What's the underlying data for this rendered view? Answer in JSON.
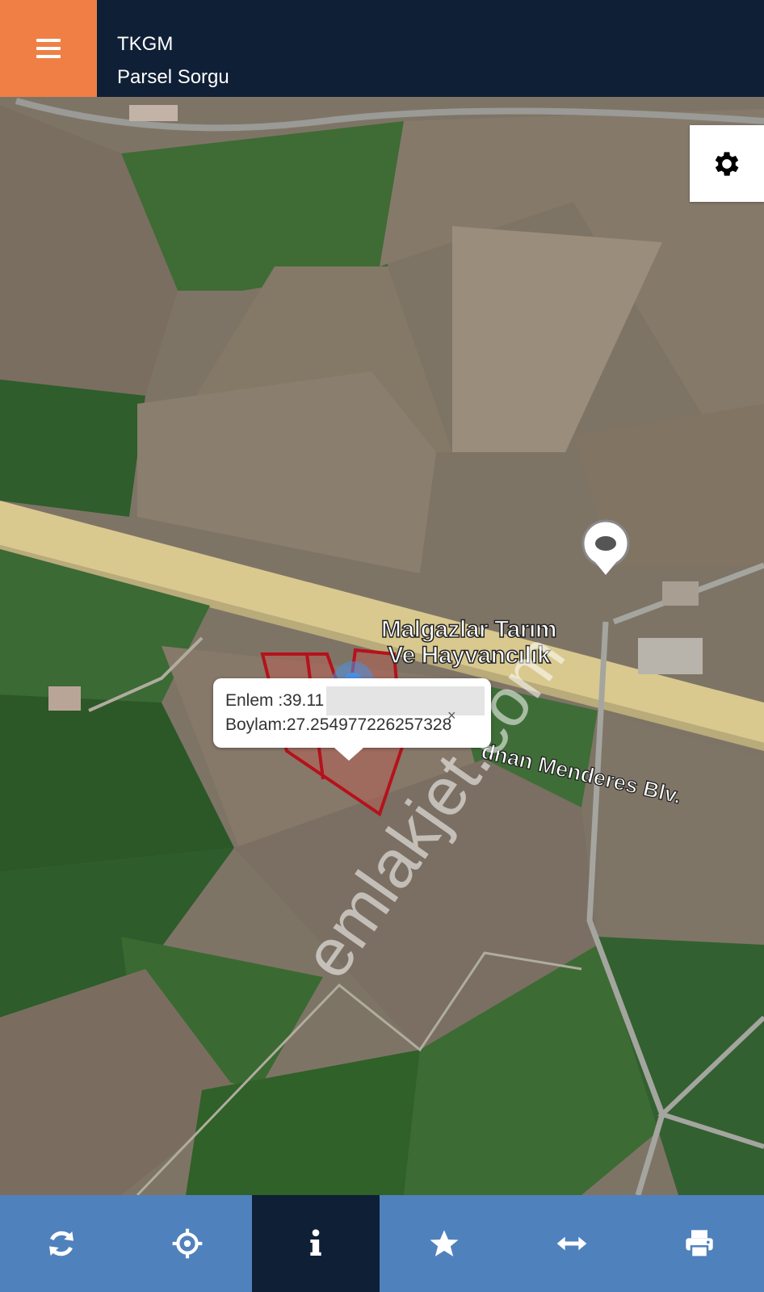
{
  "header": {
    "app_name": "TKGM",
    "subtitle": "Parsel Sorgu",
    "menu_icon": "hamburger-menu-icon"
  },
  "map": {
    "poi_label_line1": "Malgazlar Tarım",
    "poi_label_line2": "Ve Hayvancılık",
    "road_label": "dnan Menderes Blv.",
    "watermark": "emlakjet.com",
    "parcel_outline_color": "#b5121b",
    "location_marker_color": "#4a90e2"
  },
  "popup": {
    "lat_label": "Enlem  :39.11",
    "lng_label": "Boylam:27.25497722625",
    "lng_tail": "7328",
    "close_glyph": "×"
  },
  "settings": {
    "icon": "gear-icon"
  },
  "toolbar": {
    "items": [
      {
        "icon": "refresh-icon",
        "active": false
      },
      {
        "icon": "crosshair-icon",
        "active": false
      },
      {
        "icon": "info-icon",
        "active": true
      },
      {
        "icon": "star-icon",
        "active": false
      },
      {
        "icon": "measure-arrows-icon",
        "active": false
      },
      {
        "icon": "print-icon",
        "active": false
      }
    ]
  },
  "colors": {
    "header_bg": "#0f1f36",
    "menu_button_bg": "#f07f45",
    "toolbar_bg": "#4f81bd",
    "toolbar_active_bg": "#0f1f36",
    "progress": "#62a9db"
  }
}
